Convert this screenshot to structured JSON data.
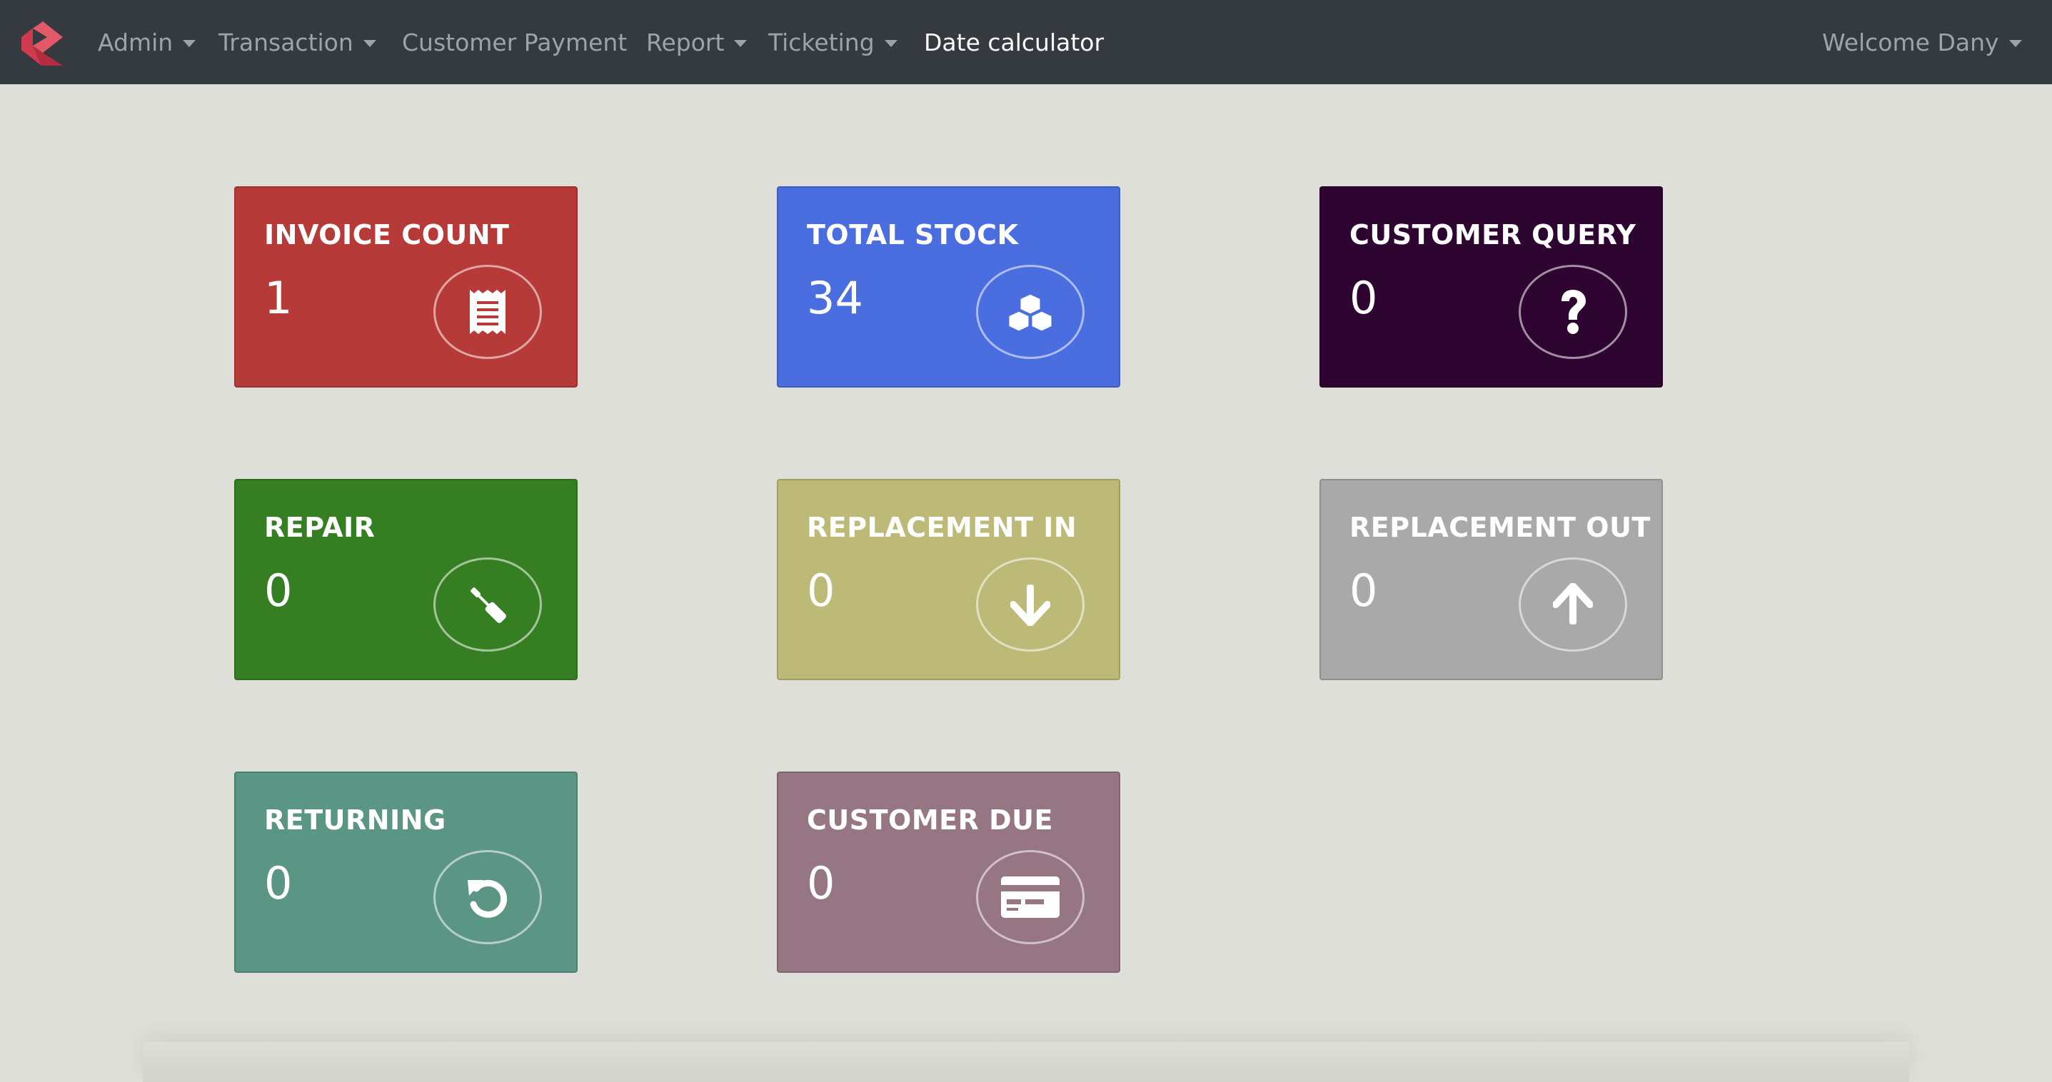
{
  "nav": {
    "items": [
      {
        "label": "Admin"
      },
      {
        "label": "Transaction"
      },
      {
        "label": "Customer Payment"
      },
      {
        "label": "Report"
      },
      {
        "label": "Ticketing"
      },
      {
        "label": "Date calculator"
      }
    ],
    "user_label": "Welcome Dany"
  },
  "cards": [
    {
      "title": "INVOICE COUNT",
      "value": "1",
      "icon": "receipt-icon",
      "color": "#b63b38"
    },
    {
      "title": "TOTAL STOCK",
      "value": "34",
      "icon": "cubes-icon",
      "color": "#4a6ddf"
    },
    {
      "title": "CUSTOMER QUERY",
      "value": "0",
      "icon": "question-icon",
      "color": "#2d0530"
    },
    {
      "title": "REPAIR",
      "value": "0",
      "icon": "screwdriver-icon",
      "color": "#357f22"
    },
    {
      "title": "REPLACEMENT IN",
      "value": "0",
      "icon": "arrow-down-icon",
      "color": "#bcba76"
    },
    {
      "title": "REPLACEMENT OUT",
      "value": "0",
      "icon": "arrow-up-icon",
      "color": "#a9a9a9"
    },
    {
      "title": "RETURNING",
      "value": "0",
      "icon": "undo-icon",
      "color": "#5b9685"
    },
    {
      "title": "CUSTOMER DUE",
      "value": "0",
      "icon": "credit-card-icon",
      "color": "#967683"
    }
  ]
}
